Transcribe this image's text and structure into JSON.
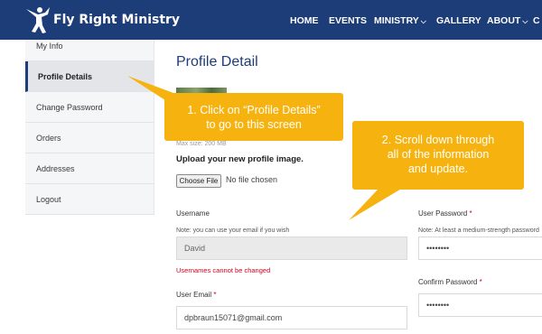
{
  "header": {
    "site_name": "Fly Right Ministry",
    "nav": [
      {
        "label": "HOME",
        "has_dropdown": false
      },
      {
        "label": "EVENTS",
        "has_dropdown": false
      },
      {
        "label": "MINISTRY",
        "has_dropdown": true
      },
      {
        "label": "GALLERY",
        "has_dropdown": false
      },
      {
        "label": "ABOUT",
        "has_dropdown": true
      },
      {
        "label": "C",
        "has_dropdown": false
      }
    ],
    "caret": "⌵"
  },
  "sidebar": {
    "items": [
      {
        "label": "My Info"
      },
      {
        "label": "Profile Details",
        "active": true
      },
      {
        "label": "Change Password"
      },
      {
        "label": "Orders"
      },
      {
        "label": "Addresses"
      },
      {
        "label": "Logout"
      }
    ]
  },
  "main": {
    "title": "Profile Detail",
    "max_size": "Max size: 200 MB",
    "upload_label": "Upload your new profile image.",
    "choose_file_label": "Choose File",
    "no_file_text": "No file chosen",
    "username": {
      "label": "Username",
      "note": "Note: you can use your email if you wish",
      "value": "David",
      "error": "Usernames cannot be changed"
    },
    "user_email": {
      "label": "User Email",
      "required_mark": "*",
      "value": "dpbraun15071@gmail.com"
    },
    "user_password": {
      "label": "User Password",
      "required_mark": "*",
      "note": "Note: At least a medium-strength password",
      "value": "••••••••"
    },
    "confirm_password": {
      "label": "Confirm Password",
      "required_mark": "*",
      "value": "••••••••"
    }
  },
  "callouts": {
    "step1_line1": "1. Click on “Profile Details”",
    "step1_line2": "to go to this screen",
    "step2_line1": "2. Scroll down through",
    "step2_line2": "all of the information",
    "step2_line3": "and update.",
    "color": "#f6b30f"
  }
}
